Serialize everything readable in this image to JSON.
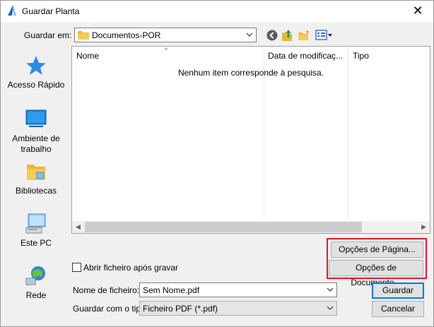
{
  "window": {
    "title": "Guardar Planta",
    "close_glyph": "✕"
  },
  "toolbar": {
    "lookin_label": "Guardar em:",
    "lookin_value": "Documentos-POR",
    "icons": [
      "back-icon",
      "up-folder-icon",
      "new-folder-icon",
      "view-menu-icon"
    ]
  },
  "sidebar": {
    "items": [
      {
        "label": "Acesso Rápido",
        "icon": "star-icon"
      },
      {
        "label": "Ambiente de trabalho",
        "icon": "desktop-icon"
      },
      {
        "label": "Bibliotecas",
        "icon": "libraries-icon"
      },
      {
        "label": "Este PC",
        "icon": "computer-icon"
      },
      {
        "label": "Rede",
        "icon": "network-icon"
      }
    ]
  },
  "filelist": {
    "columns": [
      "Nome",
      "Data de modificaç...",
      "Tipo"
    ],
    "empty_message": "Nenhum item corresponde à pesquisa."
  },
  "options": {
    "page_options": "Opções de Página...",
    "document_options": "Opções de Documento...",
    "highlight_color": "#e81123"
  },
  "open_after_save": {
    "label": "Abrir ficheiro após gravar",
    "checked": false
  },
  "filename": {
    "label": "Nome de ficheiro:",
    "value": "Sem Nome.pdf"
  },
  "filetype": {
    "label": "Guardar com o tipo:",
    "value": "Ficheiro PDF (*.pdf)"
  },
  "buttons": {
    "save": "Guardar",
    "cancel": "Cancelar"
  }
}
